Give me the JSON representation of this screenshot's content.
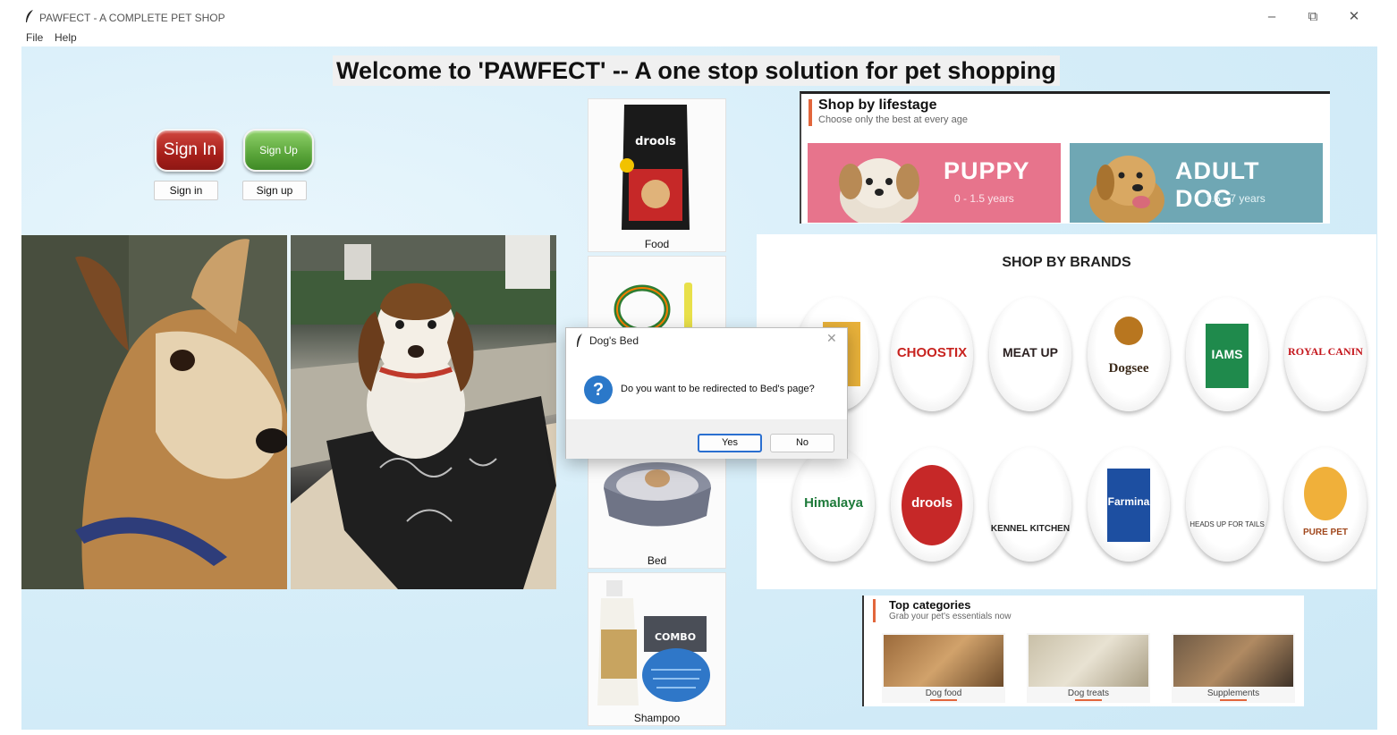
{
  "window": {
    "title": "PAWFECT - A COMPLETE PET SHOP",
    "controls": {
      "minimize": "–",
      "restore": "⧉",
      "close": "✕"
    }
  },
  "menubar": {
    "items": [
      "File",
      "Help"
    ]
  },
  "welcome": "Welcome to 'PAWFECT' -- A one stop solution for pet shopping",
  "auth": {
    "signin_image_text": "Sign In",
    "signup_image_text": "Sign Up",
    "signin_button": "Sign in",
    "signup_button": "Sign up"
  },
  "products": [
    {
      "label": "Food",
      "package_brand": "drools"
    },
    {
      "label": "Collar"
    },
    {
      "label": "Bed"
    },
    {
      "label": "Shampoo",
      "badge": "COMBO"
    }
  ],
  "lifestage": {
    "title": "Shop by lifestage",
    "subtitle": "Choose only the best at every age",
    "cards": [
      {
        "name": "PUPPY",
        "age": "0 - 1.5 years"
      },
      {
        "name": "ADULT DOG",
        "age": "1.5 - 7 years"
      }
    ]
  },
  "brands": {
    "title": "SHOP BY BRANDS",
    "row1": [
      "CHOOSTIX",
      "MEAT UP",
      "Dogsee",
      "IAMS",
      "ROYAL CANIN"
    ],
    "row2": [
      "Himalaya",
      "drools",
      "KENNEL KITCHEN",
      "Farmina",
      "HEADS UP FOR TAILS",
      "PURE PET"
    ],
    "colors": {
      "choostix": "#c8231f",
      "iams": "#1f8a4c",
      "royal_canin": "#c4161c",
      "drools": "#c62828",
      "farmina": "#1d4fa1"
    }
  },
  "top_categories": {
    "title": "Top categories",
    "subtitle": "Grab your pet's essentials now",
    "items": [
      "Dog food",
      "Dog treats",
      "Supplements"
    ]
  },
  "dialog": {
    "title": "Dog's Bed",
    "message": "Do you want to be redirected to Bed's page?",
    "yes": "Yes",
    "no": "No",
    "icon": "question-icon"
  }
}
